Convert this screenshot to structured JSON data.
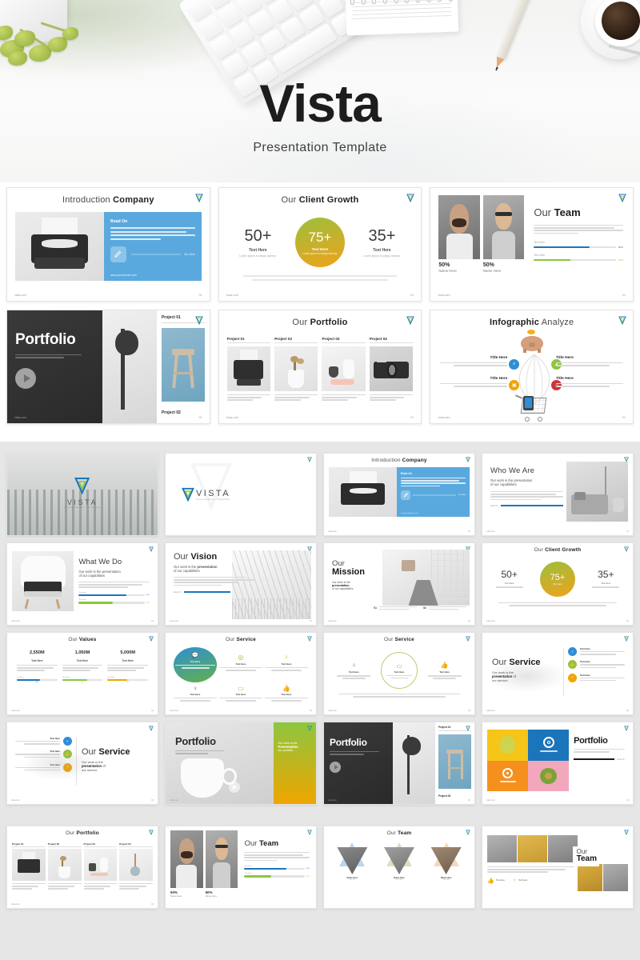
{
  "hero": {
    "title": "Vista",
    "subtitle": "Presentation Template",
    "logo_name": "vista-logo"
  },
  "brand": {
    "name": "VISTA",
    "tagline": "Presentation Template",
    "blue": "#1b75bb",
    "green": "#8dc63f",
    "accent_blue": "#4a9fd8",
    "accent_orange": "#f0a500",
    "accent_yellow": "#f2b01e",
    "accent_red": "#cf3339",
    "dark": "#3b3b3b"
  },
  "common": {
    "lorem_short": "Lorem ipsum is simply dummy text of the printing and typesetting industry.",
    "lorem_long": "Lorem ipsum is simply dummy text of the printing and typesetting industry. Lorem ipsum has been the industry's standard dummy text ever since the 1500s, when an unknown printer took a galley of type and scrambled it to make a type specimen book.",
    "footer_left": "vista.com",
    "footer_right": "01",
    "text_here": "Text Here",
    "title_here": "Title Here",
    "name_here": "Name Here",
    "read_on": "Read On",
    "go_view": "Go View",
    "website": "www.yourdomain.com",
    "our_work_line1": "Our work is the presentation",
    "our_work_line2": "of our capabilities"
  },
  "featured": {
    "row1": [
      {
        "id": "introduction-company",
        "title_light": "Introduction",
        "title_bold": "Company",
        "panel_heading": "Read On",
        "panel_body": "Lorem ipsum is simply dummy text of the printing and typesetting industry. Lorem ipsum has been the industry's standard dummy text ever since the 1500s, when an unknown printer took a galley.",
        "link_label": "Go View",
        "website": "www.yourdomain.com",
        "image": "typewriter-photo"
      },
      {
        "id": "our-client-growth",
        "title_light": "Our",
        "title_bold": "Client Growth",
        "stats": [
          {
            "value": "50+",
            "label": "Text Here",
            "caption": "Lorem ipsum is simply dummy.",
            "highlight": false
          },
          {
            "value": "75+",
            "label": "Text Here",
            "caption": "Lorem ipsum is simply dummy.",
            "highlight": true
          },
          {
            "value": "35+",
            "label": "Text Here",
            "caption": "Lorem ipsum is simply dummy.",
            "highlight": false
          }
        ],
        "body": "Lorem ipsum is simply dummy text of the printing and typesetting industry. Lorem ipsum has been the industry's standard dummy text ever since the 1500s, when an unknown printer took a galley of type and scrambled it to make a type specimen book."
      },
      {
        "id": "our-team",
        "title_light": "Our",
        "title_bold": "Team",
        "body": "Lorem ipsum is simply dummy text of the printing and typesetting industry. Lorem ipsum has been the industry's standard dummy text ever since the 1500s, when an unknown printer.",
        "members": [
          {
            "percent": "50%",
            "name": "Name Here",
            "photo": "man-laughing-photo"
          },
          {
            "percent": "50%",
            "name": "Name Here",
            "photo": "woman-glasses-photo"
          }
        ],
        "bars": [
          {
            "label": "Text Here",
            "value": "80%",
            "color": "#1b75bb",
            "fill": 68
          },
          {
            "label": "Text Here",
            "value": "47%",
            "color": "#8dc63f",
            "fill": 44
          }
        ]
      }
    ],
    "row2": [
      {
        "id": "portfolio-cover",
        "title": "Portfolio",
        "body": "Lorem ipsum is simply dummy text of the printing and typesetting industry.",
        "project_top": "Project 01",
        "project_bottom": "Project 02",
        "images": [
          "lamp-photo",
          "stool-photo"
        ]
      },
      {
        "id": "our-portfolio",
        "title_light": "Our",
        "title_bold": "Portfolio",
        "projects": [
          {
            "label": "Project 01",
            "caption": "Lorem ipsum is simply dummy text of the printing and typesetting industry.",
            "image": "typewriter-photo"
          },
          {
            "label": "Project 02",
            "caption": "Lorem ipsum is simply dummy text of the printing and typesetting industry.",
            "image": "plant-pot-photo"
          },
          {
            "label": "Project 03",
            "caption": "Lorem ipsum is simply dummy text of the printing and typesetting industry.",
            "image": "vases-photo"
          },
          {
            "label": "Project 04",
            "caption": "Lorem ipsum is simply dummy text of the printing and typesetting industry.",
            "image": "camera-photo"
          }
        ]
      },
      {
        "id": "infographic-analyze",
        "title_bold": "Infographic",
        "title_light": "Analyze",
        "nodes": [
          {
            "title": "Title Here",
            "body": "Lorem ipsum is simply dummy text of the printing and typesetting industry. Lorem ipsum has been the",
            "color": "#2e8fd4",
            "icon": "search-icon",
            "side": "left"
          },
          {
            "title": "Title Here",
            "body": "Lorem ipsum is simply dummy text of the printing and typesetting industry. Lorem ipsum has been the",
            "color": "#8dc63f",
            "icon": "thumbs-up-icon",
            "side": "right"
          },
          {
            "title": "Title Here",
            "body": "Lorem ipsum is simply dummy text of the printing and typesetting industry. Lorem ipsum has been the",
            "color": "#f0a500",
            "icon": "briefcase-icon",
            "side": "left"
          },
          {
            "title": "Title Here",
            "body": "Lorem ipsum is simply dummy text of the printing and typesetting industry. Lorem ipsum has been the",
            "color": "#cf3339",
            "icon": "home-icon",
            "side": "right"
          }
        ],
        "top_graphic": "piggy-bank-icon",
        "bottom_graphic": "shopping-cart-icon"
      }
    ]
  },
  "grid": {
    "row1": [
      {
        "id": "cover-forest",
        "kind": "cover-photo",
        "logo": "VISTA",
        "tagline": "Presentation Template",
        "image": "foggy-forest-photo"
      },
      {
        "id": "cover-white",
        "kind": "cover-white",
        "logo": "VISTA",
        "tagline": "Presentation Template"
      },
      {
        "id": "introduction-company-sm",
        "kind": "intro",
        "title_light": "Introduction",
        "title_bold": "Company",
        "panel_heading": "Read On",
        "link_label": "Go View",
        "website": "www.yourdomain.com"
      },
      {
        "id": "who-we-are",
        "kind": "split-right",
        "title": "Who We Are",
        "sub1": "Our work is the presentation",
        "sub2": "of our capabilities",
        "link_label": "Read On",
        "image": "living-room-photo"
      }
    ],
    "row2": [
      {
        "id": "what-we-do",
        "kind": "split-left",
        "title": "What We Do",
        "sub1": "Our work is the presentation",
        "sub2": "of our capabilities",
        "image": "chair-clothes-photo",
        "bars": [
          {
            "label": "Text Here",
            "value": "67%",
            "color": "#1b75bb",
            "fill": 72
          },
          {
            "label": "Text Here",
            "value": "54%",
            "color": "#8dc63f",
            "fill": 52
          }
        ]
      },
      {
        "id": "our-vision",
        "kind": "vision",
        "title_light": "Our",
        "title_bold": "Vision",
        "sub1": "Our work is the",
        "sub_bold": "presentation",
        "sub2": "of our capabilities",
        "link_label": "Read On",
        "image": "white-architecture-photo"
      },
      {
        "id": "our-mission",
        "kind": "mission",
        "title_light": "Our",
        "title_bold": "Mission",
        "sub1": "Our work is the",
        "sub_bold": "presentation",
        "sub2": "of our capabilities",
        "items": [
          {
            "num": "01",
            "text": "Lorem ipsum is simply dummy text of the printing and typesetting industry."
          },
          {
            "num": "02",
            "text": "Lorem ipsum is simply dummy text of the printing and typesetting industry."
          }
        ],
        "image": "corridor-photo"
      },
      {
        "id": "client-growth-sm",
        "kind": "growth",
        "title_light": "Our",
        "title_bold": "Client Growth",
        "stats": [
          {
            "value": "50+",
            "label": "Text Here"
          },
          {
            "value": "75+",
            "label": "Text Here"
          },
          {
            "value": "35+",
            "label": "Text Here"
          }
        ]
      }
    ],
    "row3": [
      {
        "id": "our-values",
        "kind": "values",
        "title_light": "Our",
        "title_bold": "Values",
        "items": [
          {
            "value": "2,550M",
            "label": "Text Here",
            "bar_label": "Text Here",
            "percent": "60%",
            "color": "#1b75bb",
            "fill": 58
          },
          {
            "value": "1,050M",
            "label": "Text Here",
            "bar_label": "Text Here",
            "percent": "45%",
            "color": "#8dc63f",
            "fill": 62
          },
          {
            "value": "5,000M",
            "label": "Text Here",
            "bar_label": "Text Here",
            "percent": "75%",
            "color": "#f0a500",
            "fill": 48
          }
        ]
      },
      {
        "id": "our-service-6",
        "kind": "service6",
        "title_light": "Our",
        "title_bold": "Service",
        "items": [
          {
            "label": "Text Here",
            "icon": "chat-icon",
            "color": "#2e8fd4",
            "filled": true
          },
          {
            "label": "Text Here",
            "icon": "camera-icon",
            "color": "#8dc63f",
            "filled": false
          },
          {
            "label": "Text Here",
            "icon": "bulb-icon",
            "color": "#f2b01e",
            "filled": false
          },
          {
            "label": "Text Here",
            "icon": "trophy-icon",
            "color": "#cf3339",
            "filled": false
          },
          {
            "label": "Text Here",
            "icon": "monitor-icon",
            "color": "#8dc63f",
            "filled": false
          },
          {
            "label": "Text Here",
            "icon": "thumbs-up-icon",
            "color": "#cf3339",
            "filled": false
          }
        ]
      },
      {
        "id": "our-service-3",
        "kind": "service3",
        "title_light": "Our",
        "title_bold": "Service",
        "items": [
          {
            "label": "Text Here",
            "icon": "trophy-icon",
            "color": "#2e8fd4"
          },
          {
            "label": "Text Here",
            "icon": "monitor-icon",
            "color": "#8dc63f"
          },
          {
            "label": "Text Here",
            "icon": "thumbs-up-icon",
            "color": "#f2b01e"
          }
        ],
        "body": "Lorem ipsum is simply dummy text of the printing and typesetting industry. Lorem ipsum has been the industry's standard dummy text ever since the 1500s."
      },
      {
        "id": "our-service-right",
        "kind": "service-list",
        "title_light": "Our",
        "title_bold": "Service",
        "sub1": "Our work is the",
        "sub_bold": "presentation",
        "sub_tail": "of",
        "sub2": "our service",
        "items": [
          {
            "label": "Text Here",
            "icon": "bulb-icon",
            "color": "#2e8fd4"
          },
          {
            "label": "Text Here",
            "icon": "thumbs-up-icon",
            "color": "#8dc63f"
          },
          {
            "label": "Text Here",
            "icon": "trophy-icon",
            "color": "#f0a500"
          }
        ]
      }
    ],
    "row4": [
      {
        "id": "our-service-left",
        "kind": "service-list-left",
        "title_light": "Our",
        "title_bold": "Service",
        "sub1": "Our work is the",
        "sub_bold": "presentation",
        "sub_tail": "of",
        "sub2": "our service",
        "items": [
          {
            "label": "Text Here",
            "icon": "bulb-icon",
            "color": "#2e8fd4"
          },
          {
            "label": "Text Here",
            "icon": "thumbs-up-icon",
            "color": "#8dc63f"
          },
          {
            "label": "Text Here",
            "icon": "trophy-icon",
            "color": "#f0a500"
          }
        ]
      },
      {
        "id": "portfolio-mug",
        "kind": "portfolio-mug",
        "title": "Portfolio",
        "body": "Lorem ipsum is simply dummy text of the printing and typesetting industry.",
        "panel_line1": "Our work is the",
        "panel_bold": "Presentation",
        "panel_line2": "our portfolio",
        "image": "white-mug-photo"
      },
      {
        "id": "portfolio-lamp",
        "kind": "portfolio-lamp",
        "title": "Portfolio",
        "body": "Lorem ipsum is simply dummy text of the printing and typesetting industry.",
        "project_top": "Project 01",
        "project_bottom": "Project 02",
        "images": [
          "lamp-photo",
          "stool-photo"
        ]
      },
      {
        "id": "portfolio-tiles",
        "kind": "portfolio-tiles",
        "title": "Portfolio",
        "body": "Lorem ipsum is simply dummy text of the printing and typesetting industry.",
        "link_label": "Read On",
        "tiles": [
          {
            "color": "#f5c518",
            "content": "pear-photo"
          },
          {
            "color": "#1b75bb",
            "content": "mandala-icon"
          },
          {
            "color": "#f5901e",
            "content": "mandala-icon"
          },
          {
            "color": "#f2a7bd",
            "content": "avocado-photo"
          },
          {
            "color": "#9ac63f",
            "content": "mandala-icon"
          },
          {
            "color": "#7ecfd6",
            "content": "berries-photo"
          }
        ]
      }
    ]
  },
  "bottom": {
    "row": [
      {
        "id": "our-portfolio-b",
        "kind": "portfolio4",
        "title_light": "Our",
        "title_bold": "Portfolio",
        "projects": [
          {
            "label": "Project 01",
            "image": "typewriter-photo"
          },
          {
            "label": "Project 02",
            "image": "plant-pot-photo"
          },
          {
            "label": "Project 03",
            "image": "vases-photo"
          },
          {
            "label": "Project 04",
            "image": "mirror-photo"
          }
        ],
        "caption": "Lorem ipsum is simply dummy text of the printing and typesetting industry."
      },
      {
        "id": "our-team-2",
        "kind": "team2",
        "title_light": "Our",
        "title_bold": "Team",
        "body": "Lorem ipsum is simply dummy text of the printing and typesetting industry. Lorem ipsum has been the industry's standard dummy text ever since the 1500s, when an unknown printer.",
        "members": [
          {
            "percent": "50%",
            "name": "Name Here",
            "photo": "man-laughing-photo"
          },
          {
            "percent": "50%",
            "name": "Name Here",
            "photo": "woman-glasses-photo"
          }
        ],
        "bars": [
          {
            "label": "Text Here",
            "value": "80%",
            "color": "#1b75bb",
            "fill": 70
          },
          {
            "label": "Text Here",
            "value": "47%",
            "color": "#8dc63f",
            "fill": 45
          }
        ]
      },
      {
        "id": "our-team-3",
        "kind": "team3",
        "title_light": "Our",
        "title_bold": "Team",
        "members": [
          {
            "name": "Name Here",
            "role": "Job Title",
            "tint": "#bcd6ee",
            "photo": "man-portrait-photo"
          },
          {
            "name": "Name Here",
            "role": "Job Title",
            "tint": "#d9e0c2",
            "photo": "woman-glasses-photo"
          },
          {
            "name": "Name Here",
            "role": "Job Title",
            "tint": "#f3d9bb",
            "photo": "man-beard-photo"
          }
        ]
      },
      {
        "id": "our-team-grid",
        "kind": "team-grid",
        "title_light": "Our",
        "title_bold": "Team",
        "body": "Lorem ipsum is simply dummy text of the printing and typesetting industry. Lorem ipsum has been the industry's standard dummy text ever since the 1500s, when an unknown printer.",
        "badges": [
          {
            "label": "Text Here",
            "icon": "thumbs-up-icon",
            "color": "#8dc63f"
          },
          {
            "label": "Text Here",
            "icon": "trophy-icon",
            "color": "#f2b01e"
          }
        ],
        "photos": [
          "man-smiling-photo",
          "woman-yellow-photo",
          "man-beard-photo",
          "woman-laughing-photo",
          "man-grey-photo"
        ]
      }
    ]
  }
}
